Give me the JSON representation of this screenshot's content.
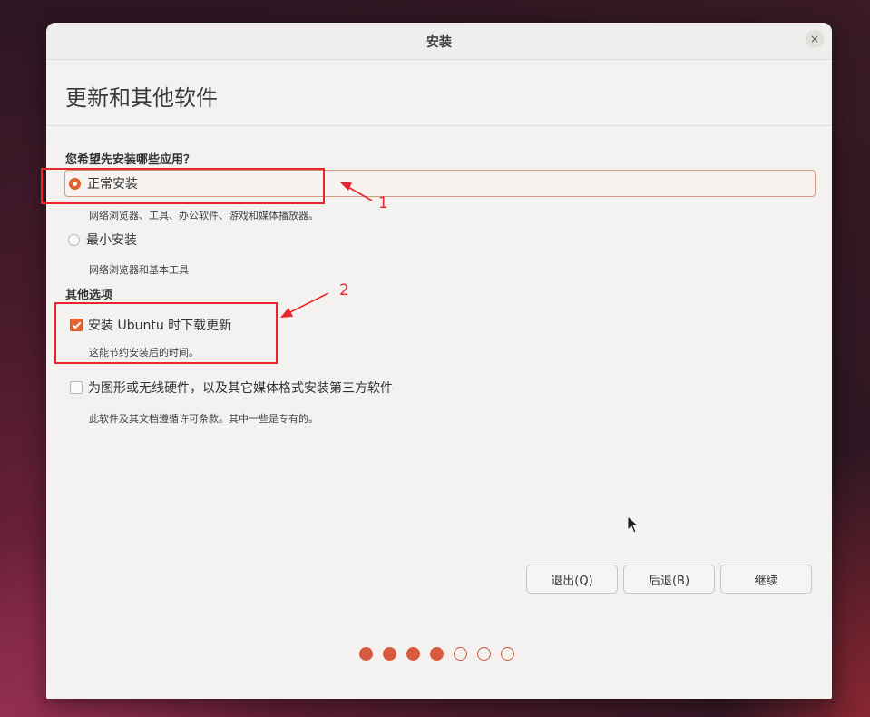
{
  "window": {
    "title": "安装",
    "close_glyph": "×"
  },
  "page": {
    "title": "更新和其他软件"
  },
  "install_type": {
    "heading": "您希望先安装哪些应用？",
    "options": [
      {
        "label": "正常安装",
        "description": "网络浏览器、工具、办公软件、游戏和媒体播放器。",
        "selected": true
      },
      {
        "label": "最小安装",
        "description": "网络浏览器和基本工具",
        "selected": false
      }
    ]
  },
  "other_options": {
    "heading": "其他选项",
    "items": [
      {
        "label": "安装 Ubuntu 时下载更新",
        "description": "这能节约安装后的时间。",
        "checked": true
      },
      {
        "label": "为图形或无线硬件，以及其它媒体格式安装第三方软件",
        "description": "此软件及其文档遵循许可条款。其中一些是专有的。",
        "checked": false
      }
    ]
  },
  "buttons": {
    "quit": "退出(Q)",
    "back": "后退(B)",
    "continue": "继续"
  },
  "progress": {
    "total_steps": 7,
    "completed_steps": 4
  },
  "annotations": {
    "label_1": "1",
    "label_2": "2",
    "color": "#e8262b"
  },
  "colors": {
    "accent": "#e9622c",
    "window_bg": "#f3f2f0"
  }
}
